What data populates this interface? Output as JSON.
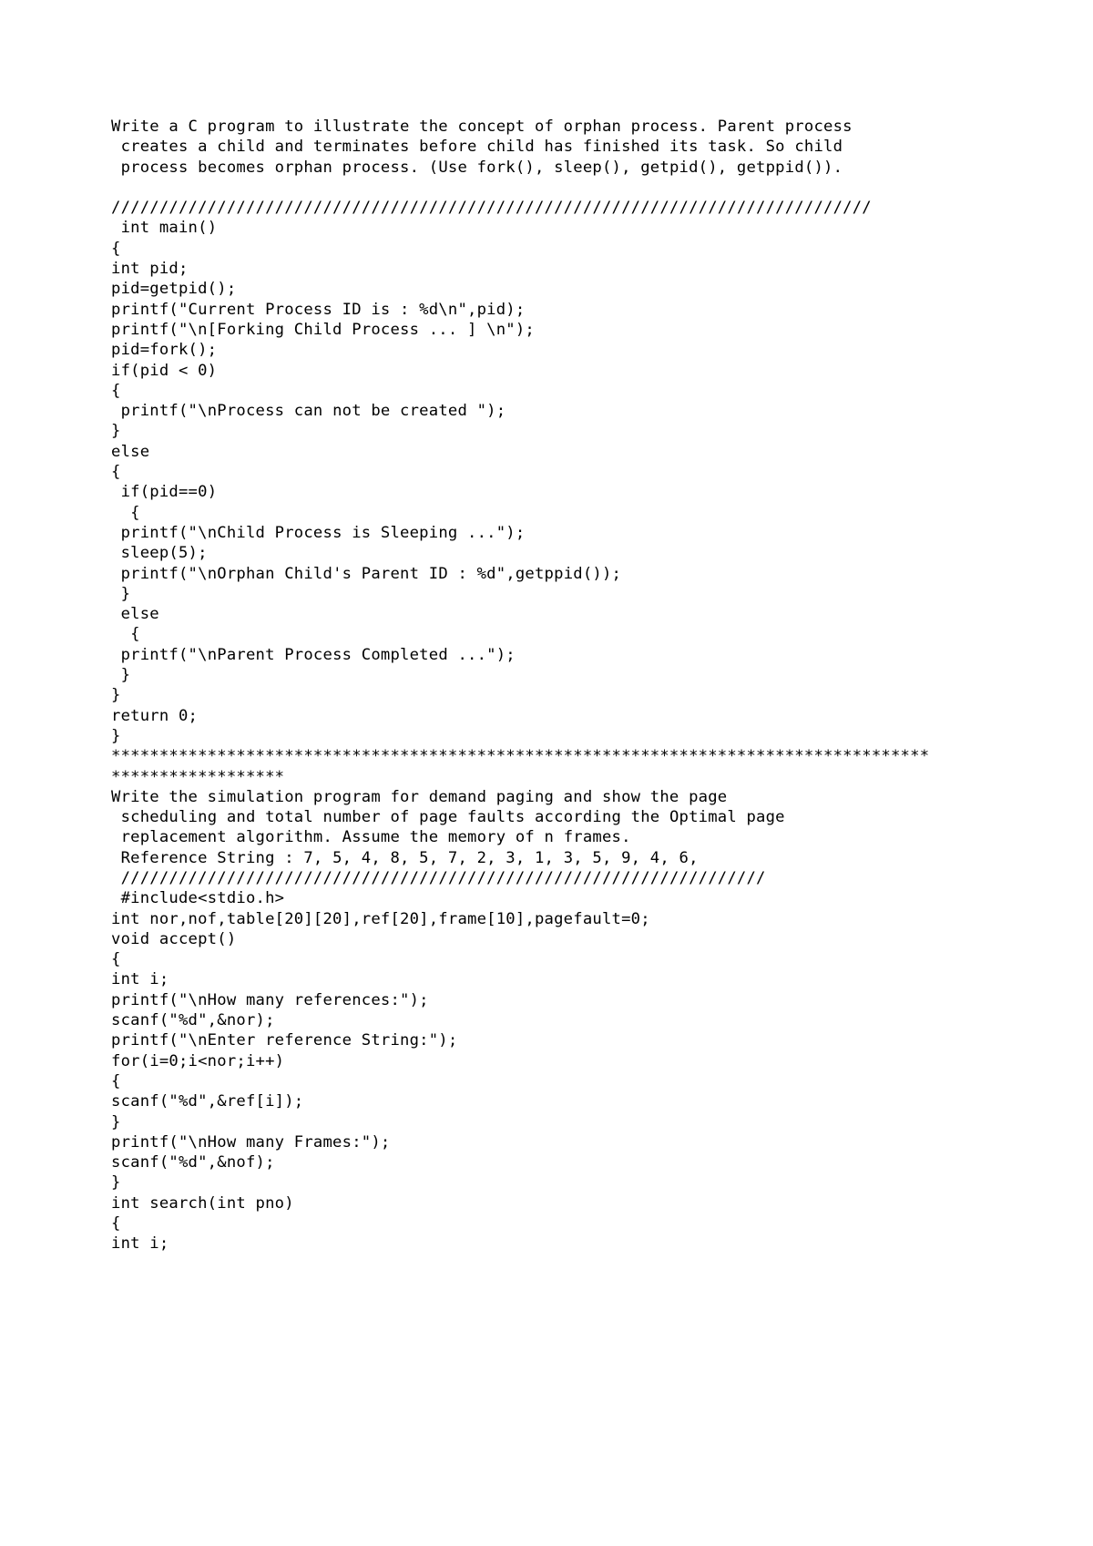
{
  "document": {
    "page_background": "#ffffff",
    "text_color": "#000000",
    "content_lines": [
      "Write a C program to illustrate the concept of orphan process. Parent process",
      " creates a child and terminates before child has finished its task. So child",
      " process becomes orphan process. (Use fork(), sleep(), getpid(), getppid()).",
      "",
      "///////////////////////////////////////////////////////////////////////////////",
      " int main()",
      "{",
      "int pid;",
      "pid=getpid();",
      "printf(\"Current Process ID is : %d\\n\",pid);",
      "printf(\"\\n[Forking Child Process ... ] \\n\");",
      "pid=fork();",
      "if(pid < 0)",
      "{",
      " printf(\"\\nProcess can not be created \");",
      "}",
      "else",
      "{",
      " if(pid==0)",
      "  {",
      " printf(\"\\nChild Process is Sleeping ...\");",
      " sleep(5);",
      " printf(\"\\nOrphan Child's Parent ID : %d\",getppid());",
      " }",
      " else",
      "  {",
      " printf(\"\\nParent Process Completed ...\");",
      " }",
      "}",
      "return 0;",
      "}",
      "*******************************************************************************************************",
      "Write the simulation program for demand paging and show the page",
      " scheduling and total number of page faults according the Optimal page",
      " replacement algorithm. Assume the memory of n frames.",
      " Reference String : 7, 5, 4, 8, 5, 7, 2, 3, 1, 3, 5, 9, 4, 6,",
      " ///////////////////////////////////////////////////////////////////",
      " #include<stdio.h>",
      "int nor,nof,table[20][20],ref[20],frame[10],pagefault=0;",
      "void accept()",
      "{",
      "int i;",
      "printf(\"\\nHow many references:\");",
      "scanf(\"%d\",&nor);",
      "printf(\"\\nEnter reference String:\");",
      "for(i=0;i<nor;i++)",
      "{",
      "scanf(\"%d\",&ref[i]);",
      "}",
      "printf(\"\\nHow many Frames:\");",
      "scanf(\"%d\",&nof);",
      "}",
      "int search(int pno)",
      "{",
      "int i;"
    ]
  }
}
